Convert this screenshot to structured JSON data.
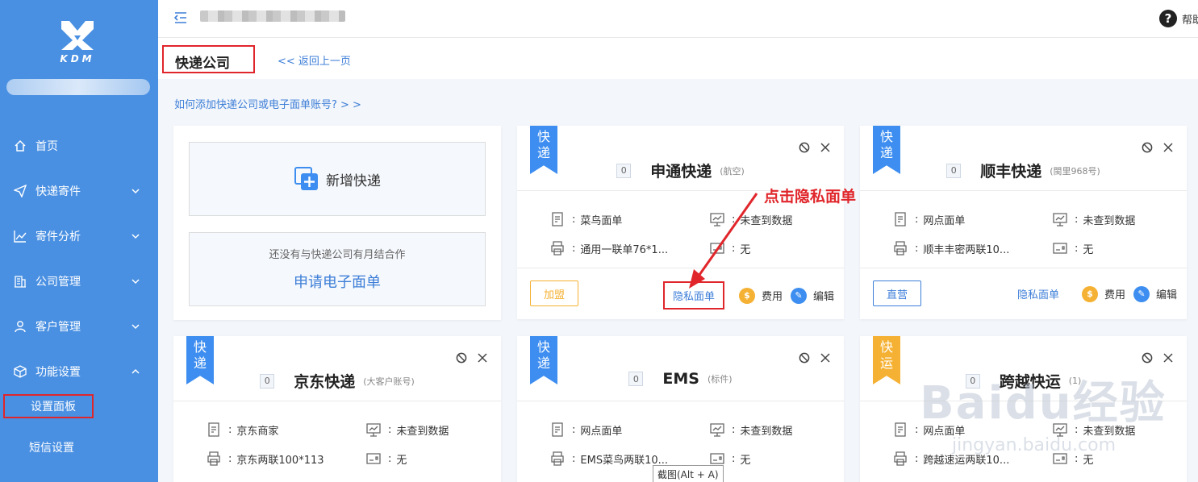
{
  "sidebar": {
    "logo_text": "KDM",
    "nav": [
      {
        "label": "首页",
        "icon": "home-icon"
      },
      {
        "label": "快递寄件",
        "icon": "send-icon"
      },
      {
        "label": "寄件分析",
        "icon": "chart-icon"
      },
      {
        "label": "公司管理",
        "icon": "building-icon"
      },
      {
        "label": "客户管理",
        "icon": "user-icon"
      },
      {
        "label": "功能设置",
        "icon": "cube-icon"
      }
    ],
    "sub_items": [
      "设置面板",
      "短信设置"
    ]
  },
  "topbar": {
    "help_label": "帮助"
  },
  "header": {
    "title": "快递公司",
    "back_label": "<< 返回上一页"
  },
  "help_link": "如何添加快递公司或电子面单账号? > >",
  "add_card": {
    "add_label": "新增快递",
    "note": "还没有与快递公司有月结合作",
    "apply_label": "申请电子面单"
  },
  "ribbon_text": {
    "kuai_di": [
      "快",
      "递"
    ],
    "kuai_yun": [
      "快",
      "运"
    ]
  },
  "common": {
    "colon": ":",
    "no_data": "未查到数据",
    "none": "无",
    "privacy": "隐私面单",
    "fee": "费用",
    "edit": "编辑"
  },
  "cards": [
    {
      "name": "申通快递",
      "sub": "(航空)",
      "count": "0",
      "sheet": "菜鸟面单",
      "template": "通用一联单76*1...",
      "tag": "加盟"
    },
    {
      "name": "顺丰快递",
      "sub": "(閩里968号)",
      "count": "0",
      "sheet": "网点面单",
      "template": "顺丰丰密两联10...",
      "tag": "直营"
    },
    {
      "name": "京东快递",
      "sub": "(大客户账号)",
      "count": "0",
      "sheet": "京东商家",
      "template": "京东两联100*113"
    },
    {
      "name": "EMS",
      "sub": "(标件)",
      "count": "0",
      "sheet": "网点面单",
      "template": "EMS菜鸟两联10..."
    },
    {
      "name": "跨越快运",
      "sub": "(1)",
      "count": "0",
      "sheet": "网点面单",
      "template": "跨越速运两联10..."
    }
  ],
  "annotation": "点击隐私面单",
  "tooltip": "截图(Alt + A)",
  "watermark": {
    "text": "Baidu经验",
    "sub": "jingyan.baidu.com"
  },
  "colors": {
    "sidebar": "#4a90e2",
    "accent": "#3d7ed8",
    "highlight": "#e0262b",
    "orange": "#f5b133"
  }
}
